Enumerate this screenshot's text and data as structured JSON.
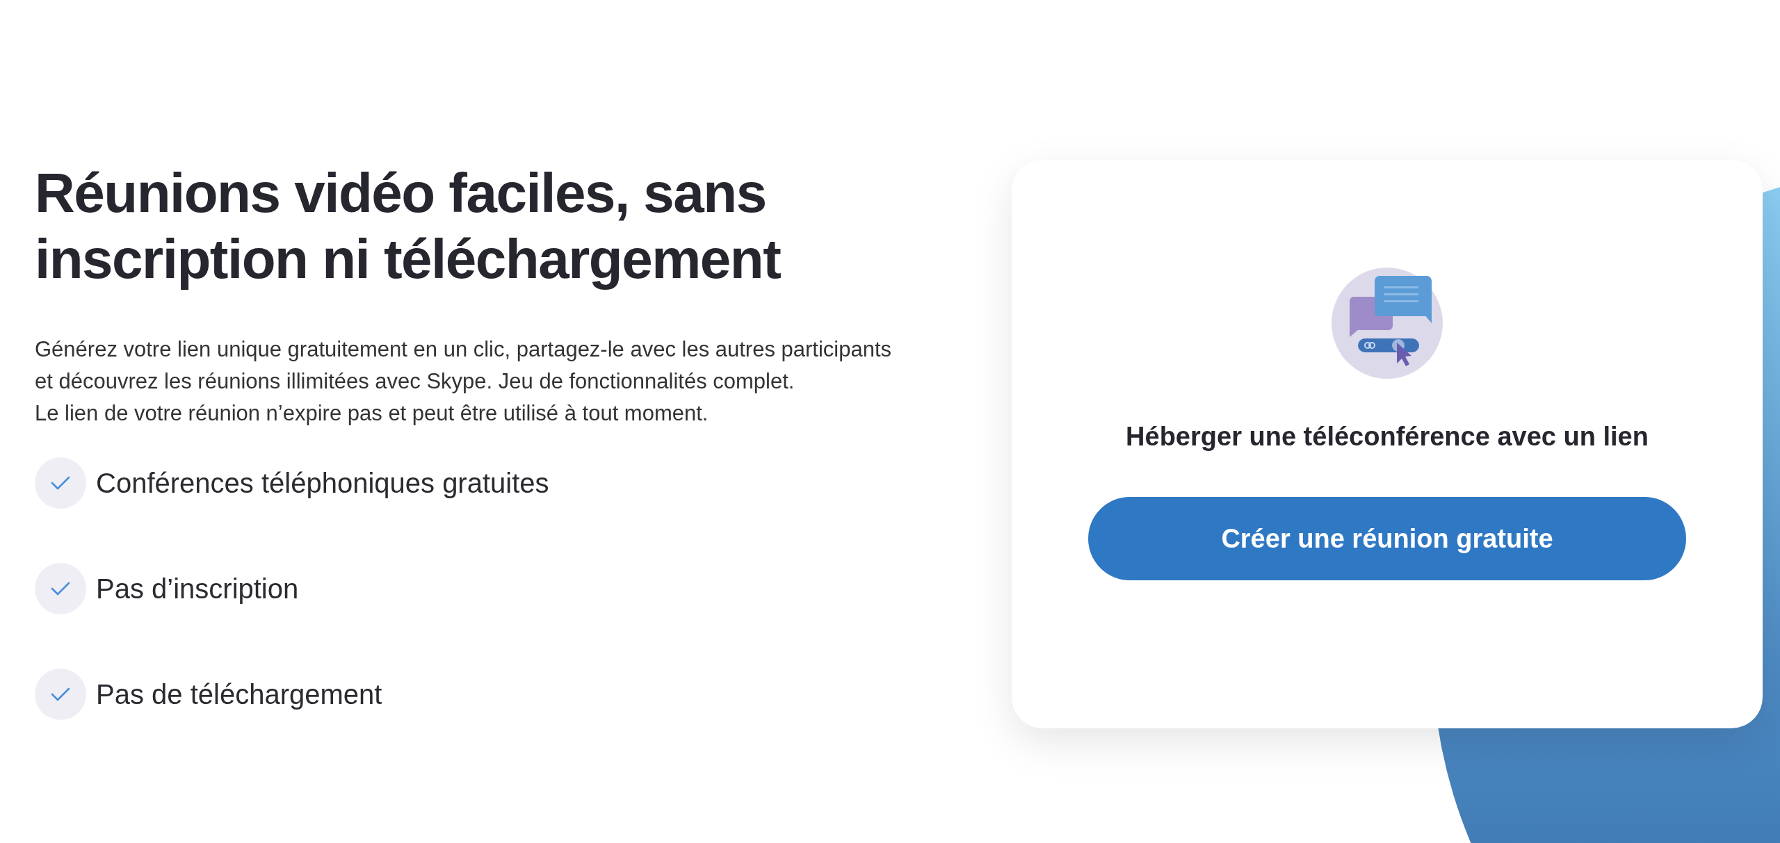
{
  "hero": {
    "title": "Réunions vidéo faciles, sans inscription ni téléchargement",
    "description": [
      "Générez votre lien unique gratuitement en un clic, partagez-le avec les autres participants et découvrez les réunions illimitées avec Skype. Jeu de fonctionnalités complet.",
      "Le lien de votre réunion n’expire pas et peut être utilisé à tout moment."
    ],
    "features": [
      {
        "label": "Conférences téléphoniques gratuites",
        "checked": true
      },
      {
        "label": "Pas d’inscription",
        "checked": true
      },
      {
        "label": "Pas de téléchargement",
        "checked": true
      }
    ]
  },
  "card": {
    "title": "Héberger une téléconférence avec un lien",
    "button": "Créer une réunion gratuite"
  }
}
